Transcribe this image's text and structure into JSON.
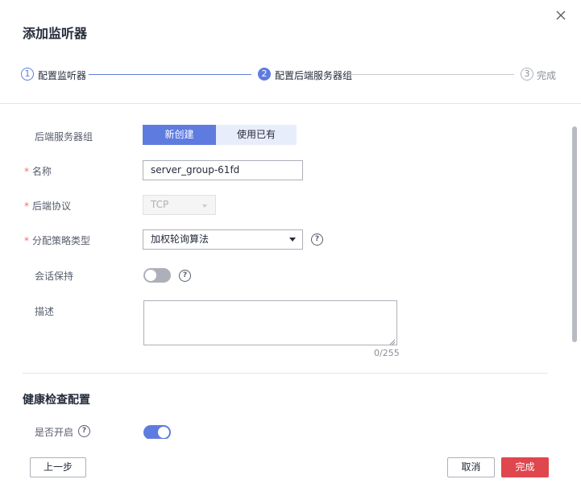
{
  "dialog": {
    "title": "添加监听器",
    "close_icon": "close-icon"
  },
  "steps": [
    {
      "num": "1",
      "label": "配置监听器",
      "state": "done"
    },
    {
      "num": "2",
      "label": "配置后端服务器组",
      "state": "active"
    },
    {
      "num": "3",
      "label": "完成",
      "state": "todo"
    }
  ],
  "form": {
    "backend_group": {
      "label": "后端服务器组",
      "options": [
        "新创建",
        "使用已有"
      ],
      "selected": "新创建"
    },
    "name": {
      "label": "名称",
      "value": "server_group-61fd",
      "required": true
    },
    "protocol": {
      "label": "后端协议",
      "value": "TCP",
      "required": true,
      "disabled": true
    },
    "algorithm": {
      "label": "分配策略类型",
      "value": "加权轮询算法",
      "required": true
    },
    "session": {
      "label": "会话保持",
      "enabled": false
    },
    "description": {
      "label": "描述",
      "value": "",
      "counter": "0/255"
    }
  },
  "health_check": {
    "title": "健康检查配置",
    "enable_label": "是否开启",
    "enabled": true
  },
  "help_glyph": "?",
  "buttons": {
    "prev": "上一步",
    "cancel": "取消",
    "finish": "完成"
  },
  "colors": {
    "accent": "#5e7ce0",
    "danger": "#e0464e",
    "required": "#f66f6a"
  }
}
